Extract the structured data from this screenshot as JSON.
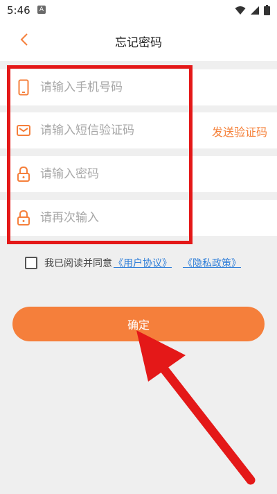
{
  "status_bar": {
    "time": "5:46",
    "notification_badge": "A",
    "icons": [
      "wifi-icon",
      "signal-icon",
      "battery-icon"
    ]
  },
  "header": {
    "title": "忘记密码",
    "back_icon": "chevron-left-icon"
  },
  "form": {
    "phone": {
      "placeholder": "请输入手机号码",
      "icon": "phone-icon"
    },
    "sms_code": {
      "placeholder": "请输入短信验证码",
      "icon": "message-icon",
      "send_label": "发送验证码"
    },
    "password": {
      "placeholder": "请输入密码",
      "icon": "lock-icon"
    },
    "password_confirm": {
      "placeholder": "请再次输入",
      "icon": "lock-icon"
    }
  },
  "agreement": {
    "text": "我已阅读并同意",
    "user_agreement": "《用户协议》",
    "privacy_policy": "《隐私政策》",
    "checked": false
  },
  "confirm_button": {
    "label": "确定"
  },
  "colors": {
    "accent": "#f57f3b",
    "link": "#2f7ed8",
    "annotation": "#e41818",
    "background": "#efefef"
  }
}
